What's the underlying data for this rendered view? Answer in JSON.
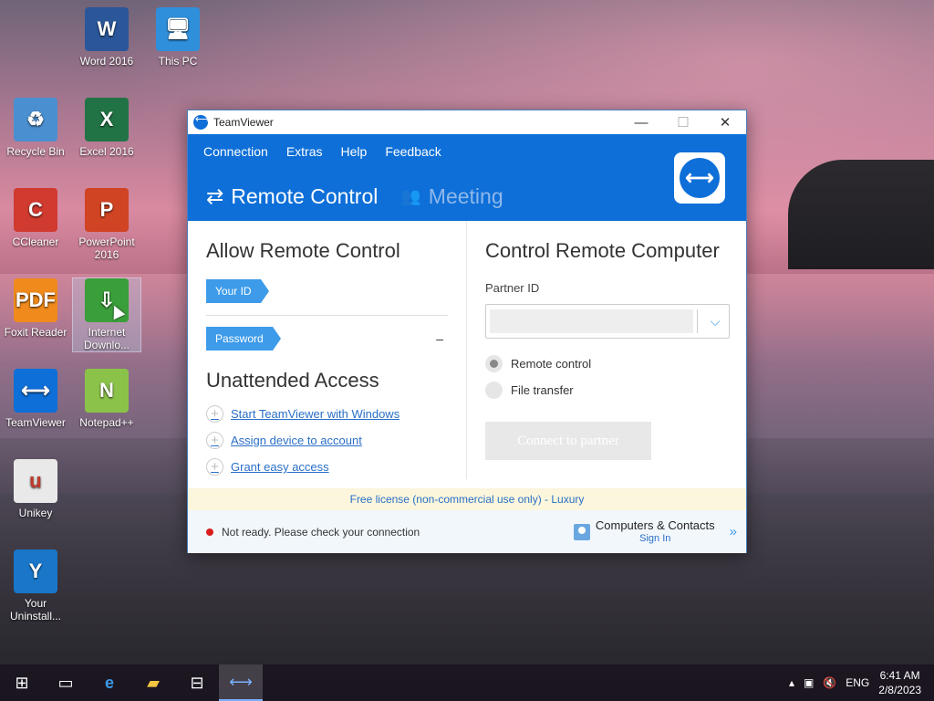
{
  "desktop": {
    "icons": [
      {
        "label": "Word 2016",
        "glyph": "W",
        "color": "#2b579a"
      },
      {
        "label": "This PC",
        "glyph": "🖥",
        "color": "#2f8fdb"
      },
      {
        "label": "Recycle Bin",
        "glyph": "♻",
        "color": "#4a8fd0"
      },
      {
        "label": "Excel 2016",
        "glyph": "X",
        "color": "#217346"
      },
      {
        "label": "CCleaner",
        "glyph": "C",
        "color": "#d03a2f"
      },
      {
        "label": "PowerPoint 2016",
        "glyph": "P",
        "color": "#d04423"
      },
      {
        "label": "Foxit Reader",
        "glyph": "PDF",
        "color": "#f08a1c"
      },
      {
        "label": "Internet Downlo...",
        "glyph": "⇩",
        "color": "#3a9e3a"
      },
      {
        "label": "TeamViewer",
        "glyph": "⟷",
        "color": "#0e6fd8"
      },
      {
        "label": "Notepad++",
        "glyph": "N",
        "color": "#8bc34a"
      },
      {
        "label": "Unikey",
        "glyph": "u",
        "color": "#e9e9e9"
      },
      {
        "label": "Your Uninstall...",
        "glyph": "Y",
        "color": "#1976c8"
      }
    ]
  },
  "window": {
    "title": "TeamViewer",
    "controls": {
      "minimize": "—",
      "maximize": "☐",
      "close": "✕"
    },
    "menu": [
      "Connection",
      "Extras",
      "Help",
      "Feedback"
    ],
    "tabs": [
      {
        "label": "Remote Control",
        "icon": "⇄",
        "active": true
      },
      {
        "label": "Meeting",
        "icon": "👥",
        "active": false
      }
    ],
    "left": {
      "title": "Allow Remote Control",
      "your_id_label": "Your ID",
      "your_id_value": "",
      "password_label": "Password",
      "password_value": "–",
      "unattended_title": "Unattended Access",
      "links": [
        "Start TeamViewer with Windows",
        "Assign device to account",
        "Grant easy access"
      ]
    },
    "right": {
      "title": "Control Remote Computer",
      "partner_label": "Partner ID",
      "partner_value": "",
      "options": [
        {
          "label": "Remote control",
          "selected": true
        },
        {
          "label": "File transfer",
          "selected": false
        }
      ],
      "connect_label": "Connect to partner"
    },
    "license": "Free license (non-commercial use only) - Luxury",
    "status": {
      "text": "Not ready. Please check your connection",
      "contacts_title": "Computers & Contacts",
      "contacts_sub": "Sign In"
    }
  },
  "taskbar": {
    "language": "ENG",
    "time": "6:41 AM",
    "date": "2/8/2023"
  }
}
